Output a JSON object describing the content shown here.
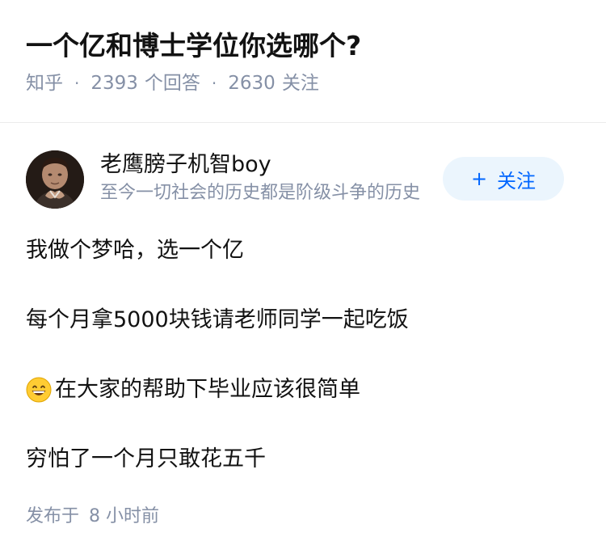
{
  "question": {
    "title": "一个亿和博士学位你选哪个?",
    "source": "知乎",
    "answer_count": "2393",
    "answer_label": "个回答",
    "follower_count": "2630",
    "follower_label": "关注",
    "separator": "·"
  },
  "author": {
    "name": "老鹰膀子机智boy",
    "bio": "至今一切社会的历史都是阶级斗争的历史",
    "follow_plus": "+",
    "follow_label": "关注"
  },
  "answer": {
    "paragraphs": [
      "我做个梦哈，选一个亿",
      "每个月拿5000块钱请老师同学一起吃饭",
      "在大家的帮助下毕业应该很简单",
      "穷怕了一个月只敢花五千"
    ],
    "emoji_name": "grinning-face-icon",
    "published_label": "发布于",
    "published_time": "8 小时前"
  },
  "colors": {
    "text": "#121212",
    "meta": "#8590a6",
    "follow_bg": "#ebf5fd",
    "follow_text": "#0066ff",
    "divider": "#ebebeb"
  }
}
